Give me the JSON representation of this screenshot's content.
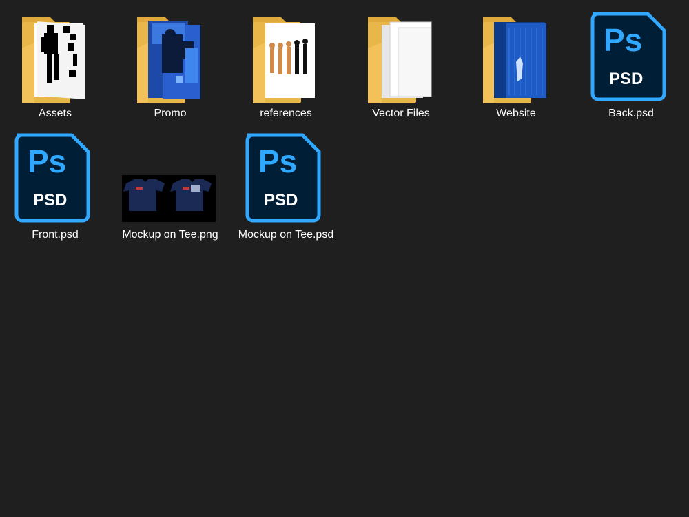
{
  "items": [
    {
      "label": "Assets",
      "kind": "folder",
      "preview": "black-white-silhouette",
      "folder_color": "#f5c75c"
    },
    {
      "label": "Promo",
      "kind": "folder",
      "preview": "blue-photo-figure",
      "folder_color": "#f5c75c"
    },
    {
      "label": "references",
      "kind": "folder",
      "preview": "evolution-figures",
      "folder_color": "#f5c75c"
    },
    {
      "label": "Vector Files",
      "kind": "folder",
      "preview": "white-documents",
      "folder_color": "#f5c75c"
    },
    {
      "label": "Website",
      "kind": "folder",
      "preview": "blue-tech-image",
      "folder_color": "#f5c75c"
    },
    {
      "label": "Back.psd",
      "kind": "psd",
      "icon": "photoshop-psd-icon",
      "icon_text": "Ps",
      "icon_subtext": "PSD",
      "accent": "#31a8ff"
    },
    {
      "label": "Front.psd",
      "kind": "psd",
      "icon": "photoshop-psd-icon",
      "icon_text": "Ps",
      "icon_subtext": "PSD",
      "accent": "#31a8ff"
    },
    {
      "label": "Mockup on Tee.png",
      "kind": "png",
      "preview": "two-navy-tshirts"
    },
    {
      "label": "Mockup on Tee.psd",
      "kind": "psd",
      "icon": "photoshop-psd-icon",
      "icon_text": "Ps",
      "icon_subtext": "PSD",
      "accent": "#31a8ff"
    }
  ]
}
